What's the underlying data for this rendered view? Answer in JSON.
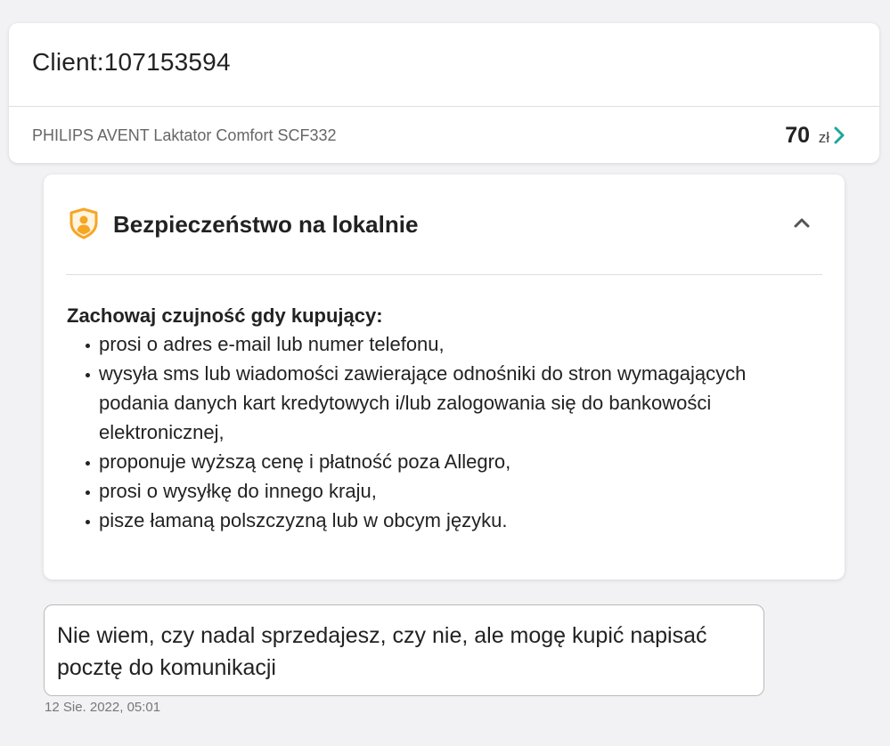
{
  "header": {
    "client_title": "Client:107153594",
    "product": {
      "name": "PHILIPS AVENT Laktator Comfort SCF332",
      "price": "70",
      "currency": "zł"
    }
  },
  "safety": {
    "title": "Bezpieczeństwo na lokalnie",
    "intro": "Zachowaj czujność gdy kupujący:",
    "items": [
      "prosi o adres e-mail lub numer telefonu,",
      "wysyła sms lub wiadomości zawierające odnośniki do stron wymagających podania danych kart kredytowych i/lub zalogowania się do bankowości elektronicznej,",
      "proponuje wyższą cenę i płatność poza Allegro,",
      "prosi o wysyłkę do innego kraju,",
      "pisze łamaną polszczyzną lub w obcym języku."
    ],
    "icon": "shield-person-icon",
    "collapse_icon": "chevron-up-icon"
  },
  "message": {
    "text": "Nie wiem, czy nadal sprzedajesz, czy nie, ale mogę kupić napisać pocztę do komunikacji",
    "timestamp": "12 Sie. 2022, 05:01"
  },
  "colors": {
    "accent": "#1aa79a",
    "shield": "#f6a623",
    "background": "#f2f2f5"
  }
}
